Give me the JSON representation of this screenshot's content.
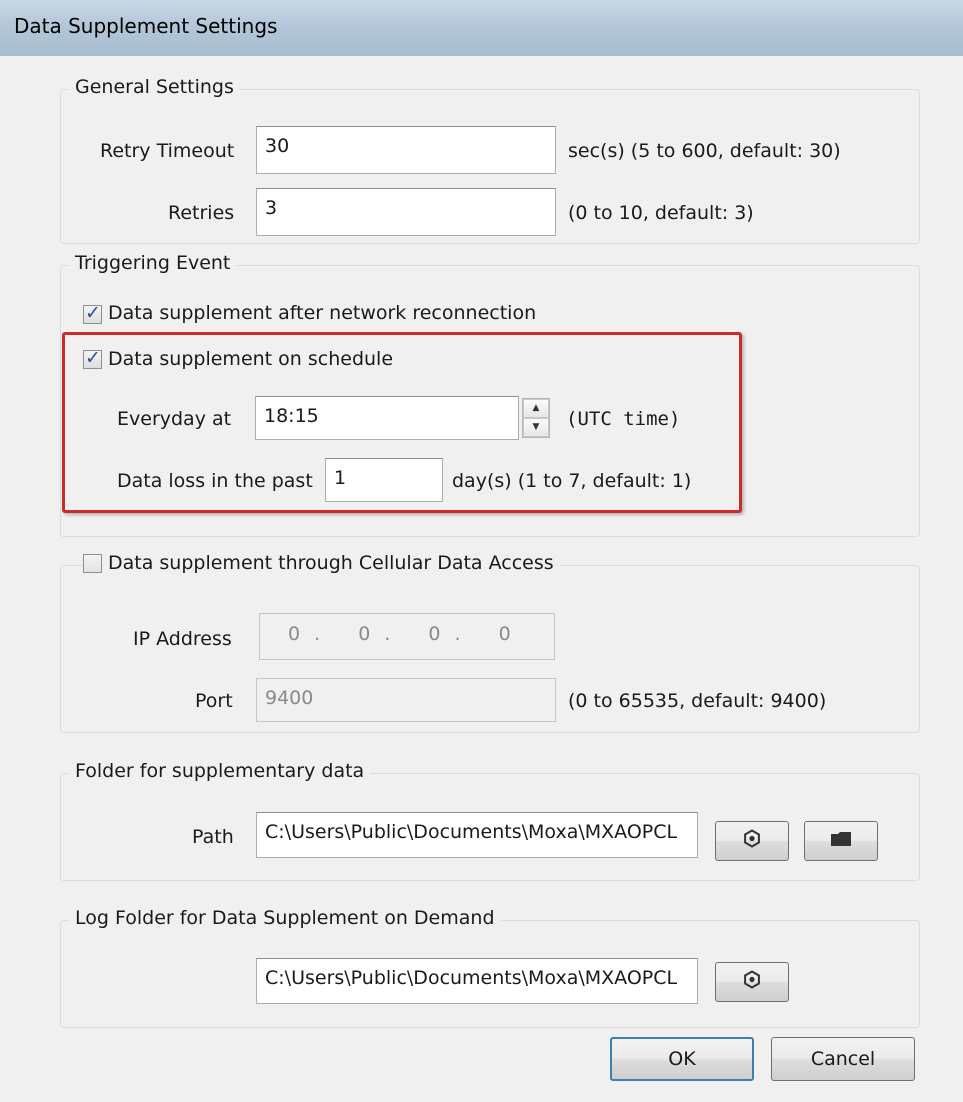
{
  "window": {
    "title": "Data Supplement Settings"
  },
  "general": {
    "title": "General Settings",
    "retry_timeout": {
      "label": "Retry Timeout",
      "value": "30",
      "hint": "sec(s) (5 to 600, default: 30)"
    },
    "retries": {
      "label": "Retries",
      "value": "3",
      "hint": "(0 to 10, default: 3)"
    }
  },
  "trigger": {
    "title": "Triggering Event",
    "reconnect": {
      "label": "Data supplement after network reconnection",
      "checked": true
    },
    "schedule": {
      "label": "Data supplement on schedule",
      "checked": true
    },
    "everyday": {
      "label": "Everyday at",
      "value": "18:15",
      "hint": "(UTC time)"
    },
    "loss": {
      "label": "Data loss in the past",
      "value": "1",
      "hint": "day(s) (1 to 7, default: 1)"
    }
  },
  "cellular": {
    "title": "Data supplement through Cellular Data Access",
    "checked": false,
    "ip": {
      "label": "IP Address",
      "octets": [
        "0",
        "0",
        "0",
        "0"
      ],
      "separator": "."
    },
    "port": {
      "label": "Port",
      "value": "9400",
      "hint": "(0 to 65535, default: 9400)"
    }
  },
  "folder": {
    "title": "Folder for supplementary data",
    "path": {
      "label": "Path",
      "value": "C:\\Users\\Public\\Documents\\Moxa\\MXAOPCL"
    }
  },
  "log": {
    "title": "Log Folder for Data Supplement on Demand",
    "path": {
      "value": "C:\\Users\\Public\\Documents\\Moxa\\MXAOPCL"
    }
  },
  "buttons": {
    "ok": "OK",
    "cancel": "Cancel"
  },
  "icons": {
    "settings": "gear-icon",
    "folder": "folder-icon",
    "check": "checkmark-icon",
    "spin_up": "spin-up-icon",
    "spin_down": "spin-down-icon"
  },
  "colors": {
    "highlight": "#cc2b2b",
    "titlebar": "#b4c7d9",
    "dialog_bg": "#f0f0f0",
    "check": "#2c4f9e",
    "default_button_border": "#3c7fb1"
  }
}
